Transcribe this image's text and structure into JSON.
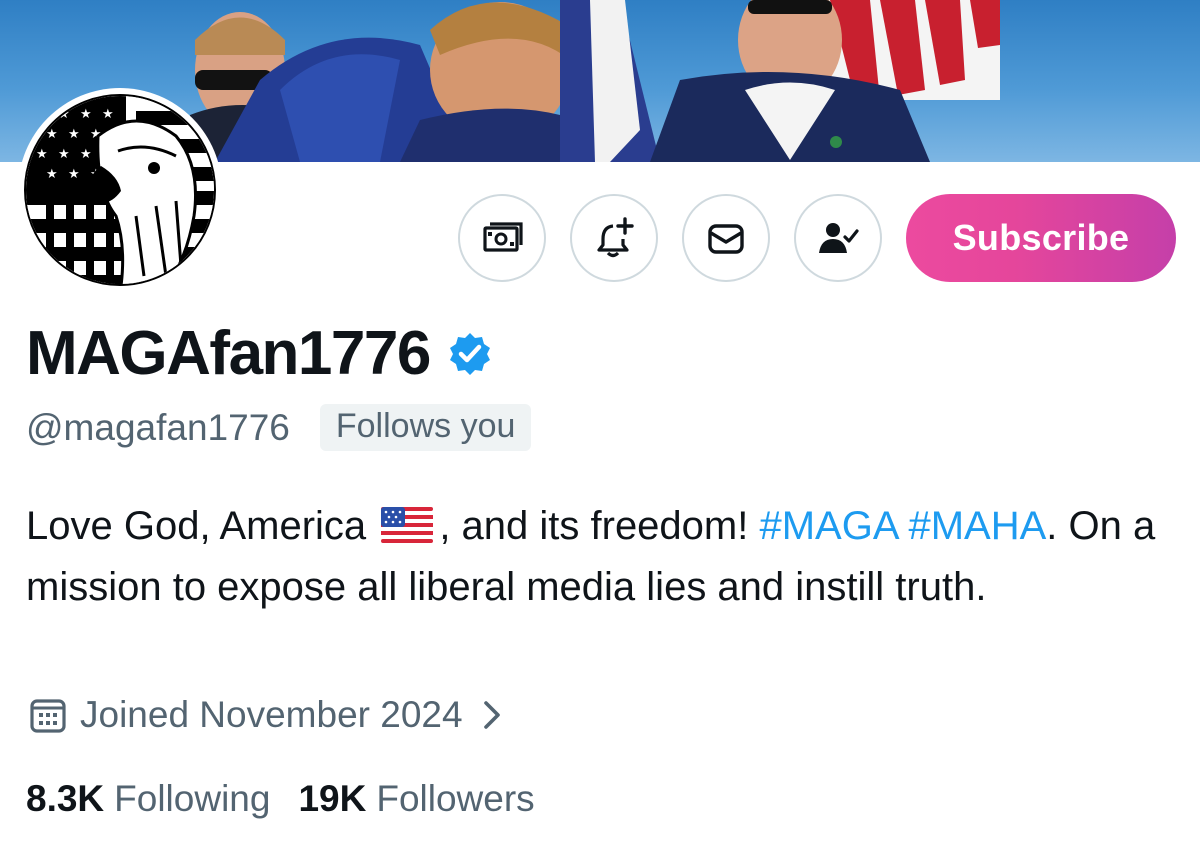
{
  "profile": {
    "display_name": "MAGAfan1776",
    "handle": "@magafan1776",
    "follows_you_badge": "Follows you",
    "bio": {
      "part1": "Love God, America",
      "part2": ", and its freedom!",
      "hashtag1": "#MAGA",
      "hashtag2": "#MAHA",
      "part3": ". On a mission to expose all liberal media lies and instill truth."
    },
    "joined": "Joined November 2024",
    "following_count": "8.3K",
    "following_label": "Following",
    "followers_count": "19K",
    "followers_label": "Followers"
  },
  "actions": {
    "tip_icon": "money-icon",
    "notify_icon": "bell-plus-icon",
    "message_icon": "envelope-icon",
    "following_icon": "user-check-icon",
    "subscribe_label": "Subscribe"
  },
  "colors": {
    "accent": "#1d9bf0",
    "subscribe_start": "#ec4a9f",
    "subscribe_end": "#c53fa9",
    "secondary_text": "#536471",
    "verified": "#1d9bf0"
  }
}
